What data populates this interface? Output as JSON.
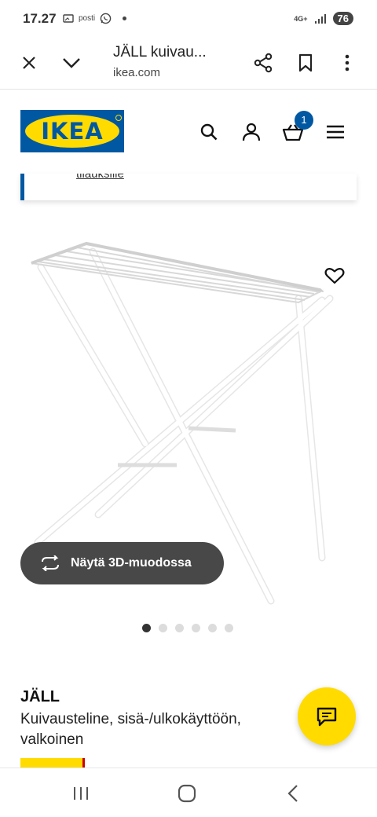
{
  "status_bar": {
    "time": "17.27",
    "icons": [
      "cast-icon",
      "posti-icon",
      "whatsapp-icon",
      "dot-icon"
    ],
    "posti_label": "posti",
    "network": "4G+",
    "battery": "76"
  },
  "browser": {
    "title": "JÄLL kuivau...",
    "url": "ikea.com"
  },
  "header": {
    "logo_text": "IKEA",
    "cart_count": "1"
  },
  "notice": {
    "link_text": "tilauksille"
  },
  "gallery": {
    "view_3d_label": "Näytä 3D-muodossa",
    "dot_count": 6,
    "active_dot": 1
  },
  "product": {
    "name": "JÄLL",
    "description": "Kuivausteline, sisä-/ulkokäyttöön, valkoinen"
  },
  "colors": {
    "ikea_blue": "#0058a3",
    "ikea_yellow": "#ffdb00",
    "dark_button": "#484848"
  }
}
